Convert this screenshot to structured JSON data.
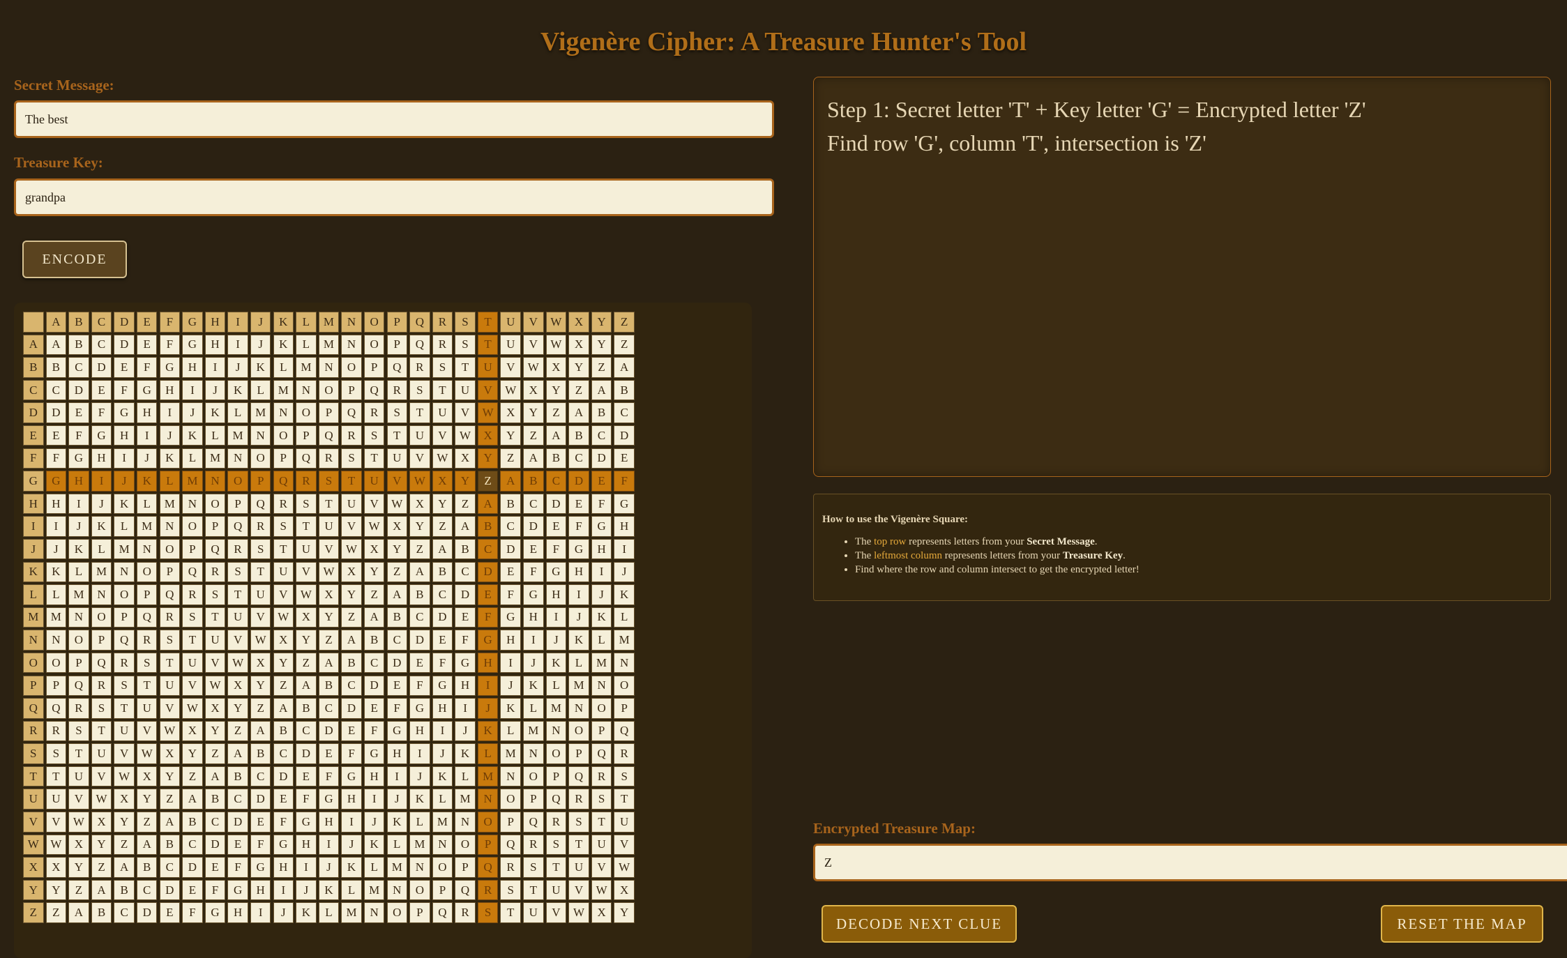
{
  "app": {
    "title": "Vigenère Cipher: A Treasure Hunter's Tool"
  },
  "inputs": {
    "message_label": "Secret Message:",
    "message_value": "The best",
    "key_label": "Treasure Key:",
    "key_value": "grandpa",
    "encode_label": "ENCODE"
  },
  "table": {
    "alphabet": "ABCDEFGHIJKLMNOPQRSTUVWXYZ",
    "highlight_row": "G",
    "highlight_col": "T",
    "result": "Z"
  },
  "step": {
    "line1": "Step 1: Secret letter 'T' + Key letter 'G' = Encrypted letter 'Z'",
    "line2": "Find row 'G', column 'T', intersection is 'Z'"
  },
  "howto": {
    "heading": "How to use the Vigenère Square:",
    "item1_pre": "The ",
    "item1_accent": "top row",
    "item1_mid": " represents letters from your ",
    "item1_bold": "Secret Message",
    "item1_end": ".",
    "item2_pre": "The ",
    "item2_accent": "leftmost column",
    "item2_mid": " represents letters from your ",
    "item2_bold": "Treasure Key",
    "item2_end": ".",
    "item3": "Find where the row and column intersect to get the encrypted letter!"
  },
  "output": {
    "label": "Encrypted Treasure Map:",
    "value": "Z",
    "decode_label": "DECODE NEXT CLUE",
    "reset_label": "RESET THE MAP"
  }
}
